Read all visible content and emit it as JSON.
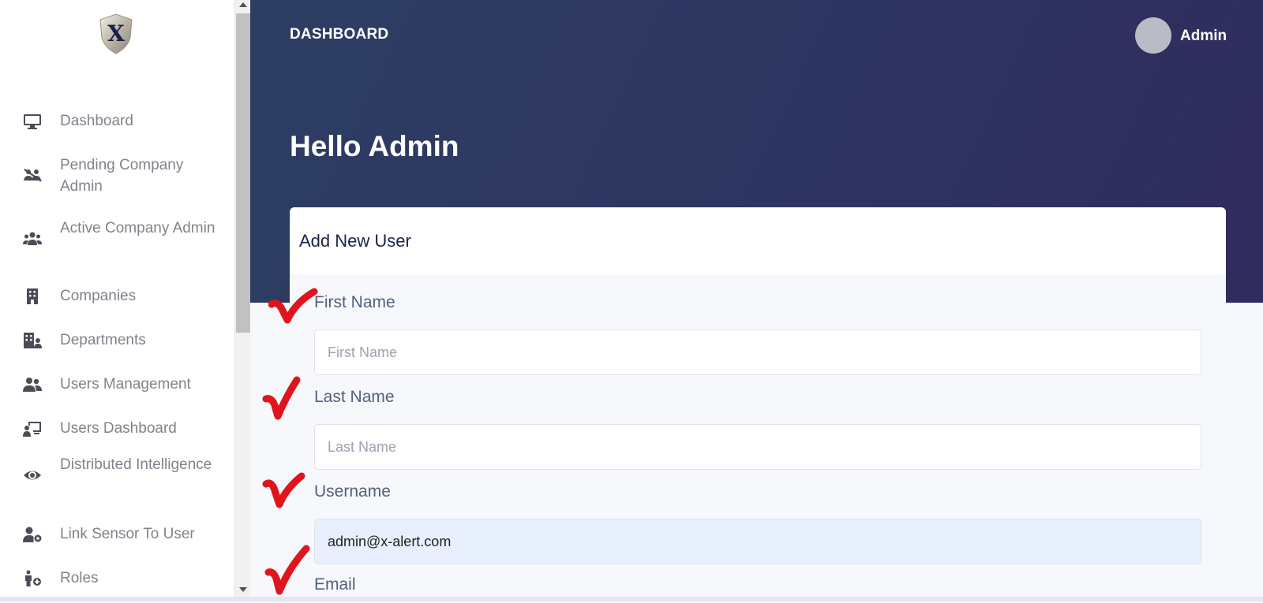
{
  "sidebar": {
    "logo_letter": "X",
    "items": [
      {
        "label": "Dashboard",
        "icon": "monitor-icon"
      },
      {
        "label": "Pending Company Admin",
        "icon": "users-slash-icon"
      },
      {
        "label": "Active Company Admin",
        "icon": "users-group-icon"
      },
      {
        "label": "Companies",
        "icon": "building-icon"
      },
      {
        "label": "Departments",
        "icon": "building-user-icon"
      },
      {
        "label": "Users Management",
        "icon": "user-friends-icon"
      },
      {
        "label": "Users Dashboard",
        "icon": "chalkboard-user-icon"
      },
      {
        "label": "Distributed Intelligence",
        "icon": "eye-icon"
      },
      {
        "label": "Link Sensor To User",
        "icon": "user-gear-icon"
      },
      {
        "label": "Roles",
        "icon": "person-plus-icon"
      }
    ]
  },
  "header": {
    "title": "DASHBOARD",
    "user_name": "Admin",
    "greeting": "Hello Admin"
  },
  "form": {
    "title": "Add New User",
    "fields": [
      {
        "label": "First Name",
        "placeholder": "First Name",
        "value": ""
      },
      {
        "label": "Last Name",
        "placeholder": "Last Name",
        "value": ""
      },
      {
        "label": "Username",
        "placeholder": "",
        "value": "admin@x-alert.com"
      },
      {
        "label": "Email",
        "placeholder": "",
        "value": ""
      }
    ]
  },
  "colors": {
    "header_gradient_start": "#2d3e62",
    "header_gradient_end": "#302c5e",
    "checkmark": "#e0141c",
    "autofill_bg": "#e8f0fe"
  }
}
